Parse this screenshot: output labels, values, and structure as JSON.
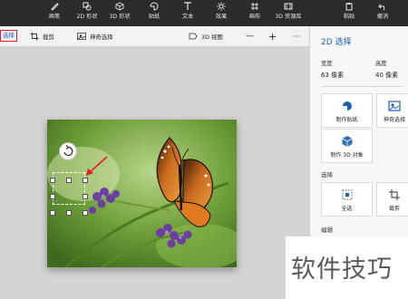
{
  "ribbon": {
    "items": [
      {
        "label": "画笔",
        "icon": "brush-icon"
      },
      {
        "label": "2D 形状",
        "icon": "2d-shapes-icon"
      },
      {
        "label": "3D 形状",
        "icon": "3d-shapes-icon"
      },
      {
        "label": "贴纸",
        "icon": "sticker-icon"
      },
      {
        "label": "文本",
        "icon": "text-icon"
      },
      {
        "label": "效果",
        "icon": "effects-icon"
      },
      {
        "label": "画布",
        "icon": "canvas-icon"
      },
      {
        "label": "3D 资源库",
        "icon": "3d-library-icon"
      },
      {
        "label": "粘贴",
        "icon": "paste-icon"
      },
      {
        "label": "撤消",
        "icon": "undo-icon"
      }
    ]
  },
  "toolbar": {
    "select_label": "选择",
    "crop_label": "裁剪",
    "magic_select_label": "神奇选择",
    "view3d_label": "3D 视图",
    "zoom_out": "—",
    "zoom_in": "+",
    "more": "···"
  },
  "panel": {
    "title": "2D 选择",
    "width_label": "宽度",
    "width_value": "63 像素",
    "height_label": "高度",
    "height_value": "40 像素",
    "make_sticker": "制作贴纸",
    "magic_select": "神奇选择",
    "make_3d": "制作 3D 对象",
    "select_section": "选择",
    "select_all": "全选",
    "crop": "裁剪",
    "edit_section": "编辑"
  },
  "watermark": "软件技巧",
  "colors": {
    "ribbon_bg": "#2b2b2b",
    "accent": "#1f5fae",
    "highlight_red": "#e0202a"
  }
}
